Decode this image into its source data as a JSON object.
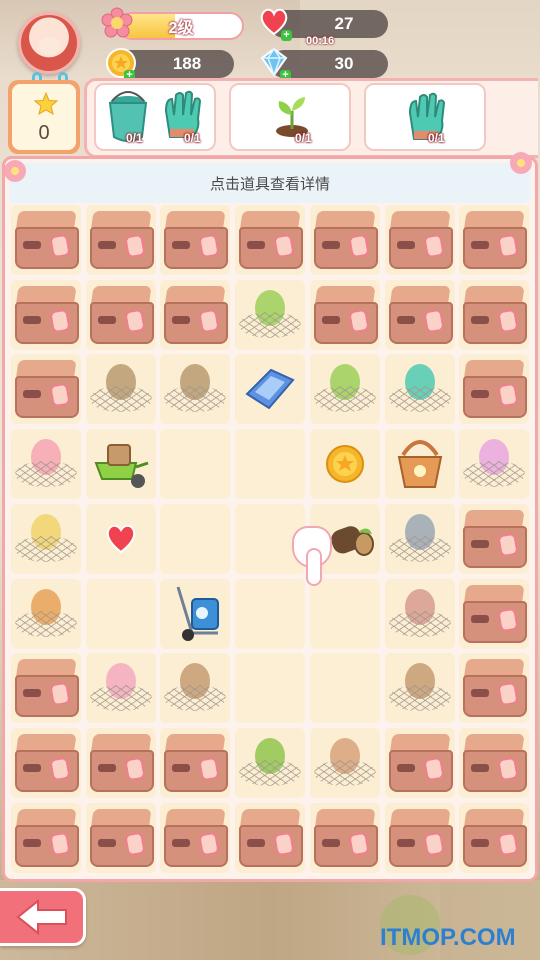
{
  "hud": {
    "level_label": "2级",
    "level_progress": 0.45,
    "hearts": "27",
    "heart_timer": "00:16",
    "coins": "188",
    "gems": "30",
    "stars": "0"
  },
  "tasks": [
    {
      "items": [
        "bucket-icon",
        "glove-icon"
      ],
      "counts": [
        "0/1",
        "0/1"
      ]
    },
    {
      "items": [
        "sprout-icon"
      ],
      "counts": [
        "0/1"
      ]
    },
    {
      "items": [
        "glove-icon"
      ],
      "counts": [
        "0/1"
      ]
    }
  ],
  "board": {
    "hint": "点击道具查看详情",
    "rows": [
      [
        "box",
        "box",
        "box",
        "box",
        "box",
        "box",
        "box"
      ],
      [
        "box",
        "box",
        "box",
        "webbed-sprout",
        "box",
        "box",
        "box"
      ],
      [
        "box",
        "webbed-seed",
        "webbed-seed",
        "ice-block",
        "webbed-sprout",
        "webbed-glove",
        "box"
      ],
      [
        "webbed-flag",
        "wheelbarrow",
        "empty",
        "empty",
        "coin",
        "basket",
        "webbed-ribbon"
      ],
      [
        "webbed-bag",
        "heart",
        "empty",
        "empty",
        "log",
        "webbed-tap",
        "box"
      ],
      [
        "webbed-carrot",
        "empty",
        "hand-truck",
        "empty",
        "empty",
        "webbed-branch",
        "box"
      ],
      [
        "box",
        "webbed-blossom",
        "webbed-stump",
        "empty",
        "empty",
        "webbed-stump",
        "box"
      ],
      [
        "box",
        "box",
        "box",
        "webbed-wheelbarrow",
        "webbed-planks",
        "box",
        "box"
      ],
      [
        "box",
        "box",
        "box",
        "box",
        "box",
        "box",
        "box"
      ]
    ]
  },
  "watermark": "ITMOP.COM",
  "colors": {
    "accent_pink": "#f2a8a8",
    "board_bg": "#fdf2ec",
    "cell_bg": "#fbeed3",
    "back_button": "#f2707a",
    "watermark": "#2f7fd0"
  }
}
